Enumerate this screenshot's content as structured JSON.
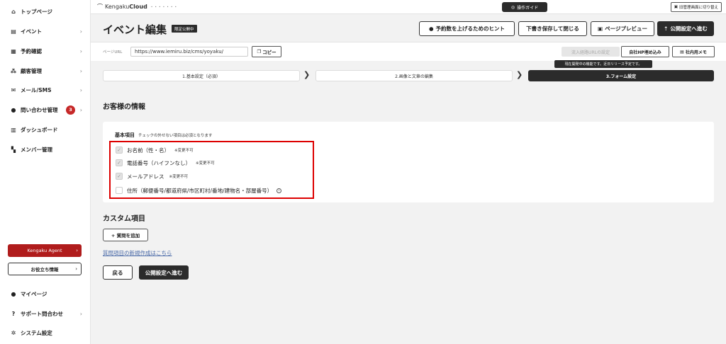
{
  "sidebar": {
    "items": [
      {
        "label": "トップページ",
        "icon": "home-icon"
      },
      {
        "label": "イベント",
        "icon": "document-icon"
      },
      {
        "label": "予約確認",
        "icon": "calendar-icon"
      },
      {
        "label": "顧客管理",
        "icon": "users-icon"
      },
      {
        "label": "メール/SMS",
        "icon": "mail-icon"
      },
      {
        "label": "問い合わせ管理",
        "icon": "chat-icon",
        "badge": "3"
      },
      {
        "label": "ダッシュボード",
        "icon": "chart-icon"
      },
      {
        "label": "メンバー管理",
        "icon": "grid-icon"
      }
    ],
    "agent_button": "Kengaku Agent",
    "useful_button": "お役立ち情報",
    "bottom_items": [
      {
        "label": "マイページ",
        "icon": "person-icon"
      },
      {
        "label": "サポート問合わせ",
        "icon": "question-icon"
      },
      {
        "label": "システム設定",
        "icon": "gear-icon"
      }
    ]
  },
  "topbar": {
    "logo": "Kengaku",
    "logo_bold": "Cloud",
    "logo_sub": "• • • • • • •",
    "guide_button": "操作ガイド",
    "old_screen_button": "旧管理画面に切り替え"
  },
  "header": {
    "title": "イベント編集",
    "status_tag": "限定公開中",
    "buttons": {
      "hint": "予約数を上げるためのヒント",
      "save_close": "下書き保存して閉じる",
      "preview": "ページプレビュー",
      "publish": "公開設定へ進む"
    }
  },
  "url_row": {
    "label": "ページURL",
    "url": "https://www.iemiru.biz/cms/yoyaku/",
    "copy_button": "コピー",
    "inflow_button": "流入経路URLの設定",
    "embed_button": "自社HP埋め込み",
    "memo_button": "社内用メモ",
    "tooltip": "現在開発中の機能です。近日リリース予定です。"
  },
  "steps": [
    "1.基本設定（必須）",
    "2.画像と文章の編集",
    "3.フォーム設定"
  ],
  "customer_section": {
    "title": "お客様の情報",
    "basic_title": "基本項目",
    "basic_note": "チェックの外せない項目は必須となります",
    "fields": [
      {
        "label": "お名前（性・名）",
        "note": "※変更不可",
        "checked": true
      },
      {
        "label": "電話番号（ハイフンなし）",
        "note": "※変更不可",
        "checked": true
      },
      {
        "label": "メールアドレス",
        "note": "※変更不可",
        "checked": true
      },
      {
        "label": "住所（郵便番号/都道府県/市区町村/番地/建物名・部屋番号）",
        "note": "",
        "checked": false
      }
    ]
  },
  "custom_section": {
    "title": "カスタム項目",
    "add_button": "+ 質問を追加",
    "new_link": "質問項目の新規作成はこちら"
  },
  "footer": {
    "back_button": "戻る",
    "proceed_button": "公開設定へ進む"
  },
  "colors": {
    "accent_dark": "#2b2b2b",
    "agent_red": "#b01c1c",
    "highlight_red": "#dd0000",
    "link_blue": "#4a6aa8"
  }
}
